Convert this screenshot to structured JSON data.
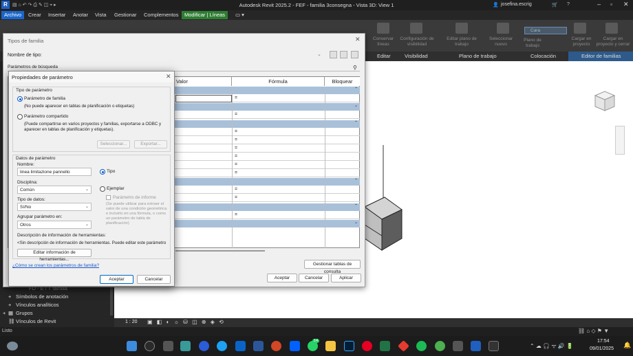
{
  "app": {
    "title": "Autodesk Revit 2025.2 - FEF - familia 3consegna - Vista 3D: View 1",
    "user": "josefina.escrig"
  },
  "menu": {
    "tabs": [
      "Archivo",
      "Crear",
      "Insertar",
      "Anotar",
      "Vista",
      "Gestionar",
      "Complementos",
      "Modificar | Líneas"
    ]
  },
  "ribbon": {
    "buttons": [
      "Conservar líneas",
      "Configuración de visibilidad",
      "Editar plano de trabajo",
      "Seleccionar nuevo",
      "Plano de trabajo",
      "Cargar en proyecto",
      "Cargar en proyecto y cerrar"
    ],
    "category_combo": "Cara",
    "panels": [
      "Editar",
      "Visibilidad",
      "Plano de trabajo",
      "Colocación",
      "Editor de familias"
    ]
  },
  "browser": {
    "items": [
      "FD - E / T familia",
      "Símbolos de anotación",
      "Vínculos analíticos",
      "Grupos",
      "Vínculos de Revit"
    ]
  },
  "view_status": {
    "scale": "1 : 20"
  },
  "status_bar": {
    "text": "Listo"
  },
  "taskbar": {
    "time": "17:54",
    "date": "09/01/2025",
    "badge": "14"
  },
  "family_types": {
    "title": "Tipos de familia",
    "type_name_label": "Nombre de tipo:",
    "search_label": "Parámetros de búsqueda",
    "columns": [
      "Valor",
      "Fórmula",
      "Bloquear"
    ],
    "formula_equals": "=",
    "manage_lookup_button": "Gestionar tablas de consulta",
    "ok": "Aceptar",
    "cancel": "Cancelar",
    "apply": "Aplicar"
  },
  "param_props": {
    "title": "Propiedades de parámetro",
    "param_type_legend": "Tipo de parámetro",
    "family_param": "Parámetro de familia",
    "family_param_note": "(No puede aparecer en tablas de planificación o etiquetas)",
    "shared_param": "Parámetro compartido",
    "shared_param_note": "(Puede compartirse en varios proyectos y familias, exportarse a ODBC y aparecer en tablas de planificación y etiquetas).",
    "select_button": "Seleccionar...",
    "export_button": "Exportar...",
    "data_legend": "Datos de parámetro",
    "name_label": "Nombre:",
    "name_value": "linea limitazione pannello",
    "type_option": "Tipo",
    "instance_option": "Ejemplar",
    "report_param": "Parámetro de informe",
    "report_note": "(Se puede utilizar para extraer el valor de una condición geométrica e incluirlo en una fórmula, o como un parámetro de tabla de planificación)",
    "discipline_label": "Disciplina:",
    "discipline_value": "Común",
    "datatype_label": "Tipo de datos:",
    "datatype_value": "Sí/No",
    "group_label": "Agrupar parámetro en:",
    "group_value": "Otros",
    "tooltip_label": "Descripción de información de herramientas:",
    "tooltip_text": "<Sin descripción de información de herramientas. Puede editar este parámetro",
    "edit_tooltip_button": "Editar información de herramientas...",
    "help_link": "¿Cómo se crean los parámetros de familia?",
    "ok": "Aceptar",
    "cancel": "Cancelar"
  }
}
